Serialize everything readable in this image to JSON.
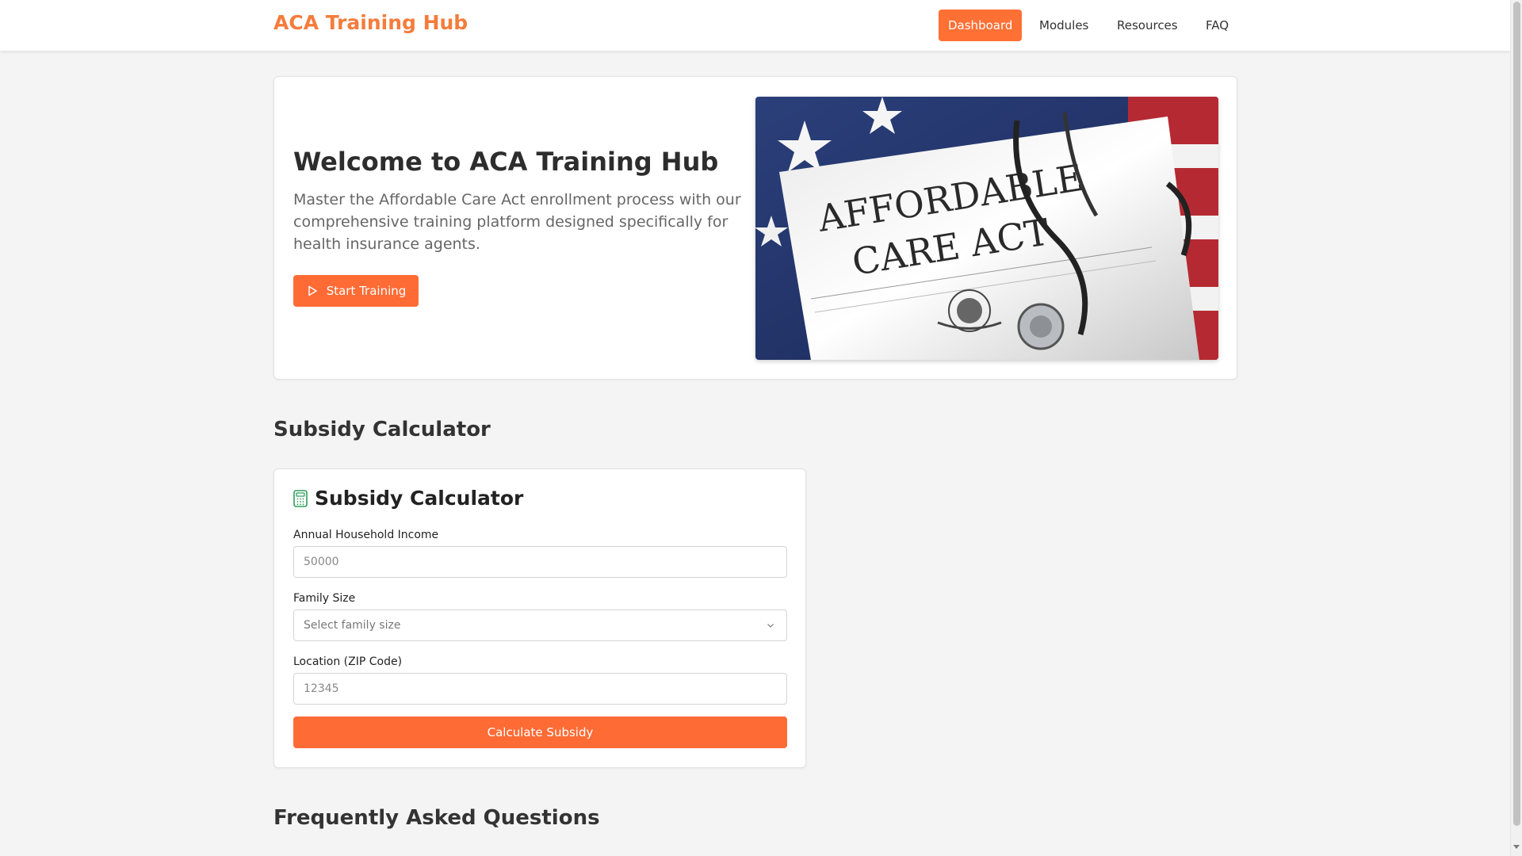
{
  "nav": {
    "brand": "ACA Training Hub",
    "items": [
      {
        "label": "Dashboard",
        "active": true
      },
      {
        "label": "Modules",
        "active": false
      },
      {
        "label": "Resources",
        "active": false
      },
      {
        "label": "FAQ",
        "active": false
      }
    ]
  },
  "hero": {
    "title": "Welcome to ACA Training Hub",
    "description": "Master the Affordable Care Act enrollment process with our comprehensive training platform designed specifically for health insurance agents.",
    "cta_label": "Start Training",
    "cta_icon": "play-icon",
    "image_text_line1": "AFFORDABLE",
    "image_text_line2": "CARE ACT"
  },
  "calculator_section": {
    "heading": "Subsidy Calculator",
    "card_title": "Subsidy Calculator",
    "card_icon": "calculator-icon",
    "fields": {
      "income": {
        "label": "Annual Household Income",
        "placeholder": "50000"
      },
      "family": {
        "label": "Family Size",
        "placeholder": "Select family size"
      },
      "zip": {
        "label": "Location (ZIP Code)",
        "placeholder": "12345"
      }
    },
    "submit_label": "Calculate Subsidy"
  },
  "faq_section": {
    "heading": "Frequently Asked Questions"
  },
  "colors": {
    "accent": "#ff6b35",
    "brand": "#f47c3c",
    "calc_icon": "#2e9e5b"
  }
}
